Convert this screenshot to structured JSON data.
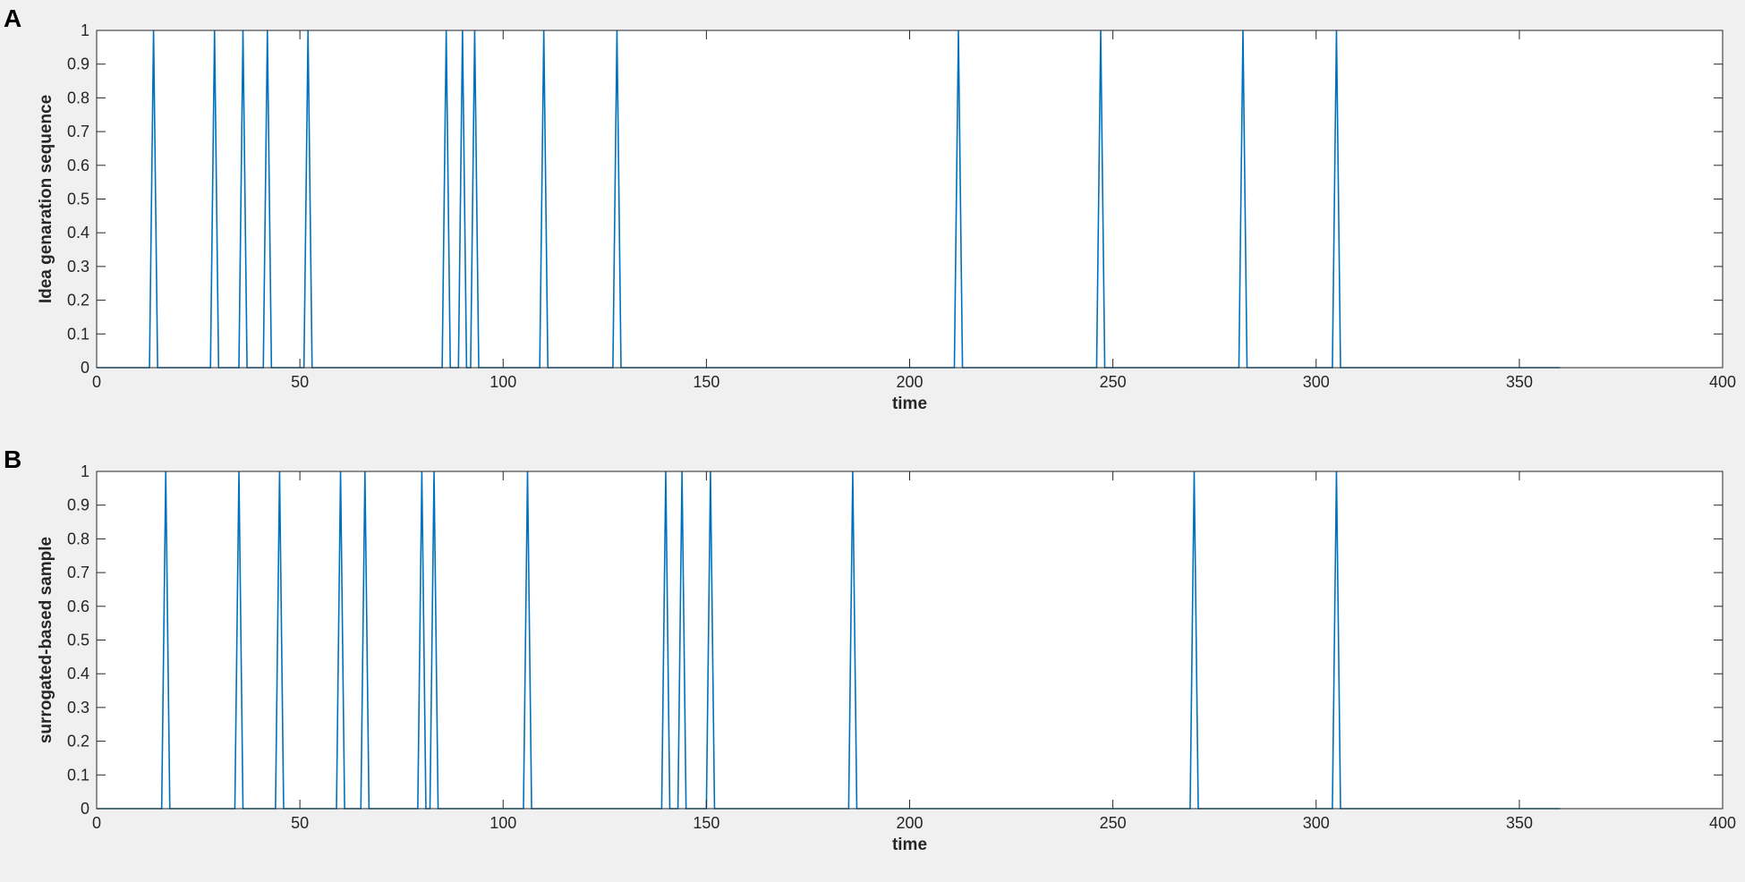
{
  "chart_data": [
    {
      "panel_label": "A",
      "type": "line",
      "xlabel": "time",
      "ylabel": "Idea genaration sequence",
      "xlim": [
        0,
        400
      ],
      "ylim": [
        0,
        1
      ],
      "xticks": [
        0,
        50,
        100,
        150,
        200,
        250,
        300,
        350,
        400
      ],
      "yticks": [
        0,
        0.1,
        0.2,
        0.3,
        0.4,
        0.5,
        0.6,
        0.7,
        0.8,
        0.9,
        1
      ],
      "x_end": 360,
      "spike_times": [
        14,
        29,
        36,
        42,
        52,
        86,
        90,
        93,
        110,
        128,
        212,
        247,
        282,
        305
      ],
      "color": "#0072bd"
    },
    {
      "panel_label": "B",
      "type": "line",
      "xlabel": "time",
      "ylabel": "surrogated-based sample",
      "xlim": [
        0,
        400
      ],
      "ylim": [
        0,
        1
      ],
      "xticks": [
        0,
        50,
        100,
        150,
        200,
        250,
        300,
        350,
        400
      ],
      "yticks": [
        0,
        0.1,
        0.2,
        0.3,
        0.4,
        0.5,
        0.6,
        0.7,
        0.8,
        0.9,
        1
      ],
      "x_end": 360,
      "spike_times": [
        17,
        35,
        45,
        60,
        66,
        80,
        83,
        106,
        140,
        144,
        151,
        186,
        270,
        305
      ],
      "color": "#0072bd"
    }
  ]
}
